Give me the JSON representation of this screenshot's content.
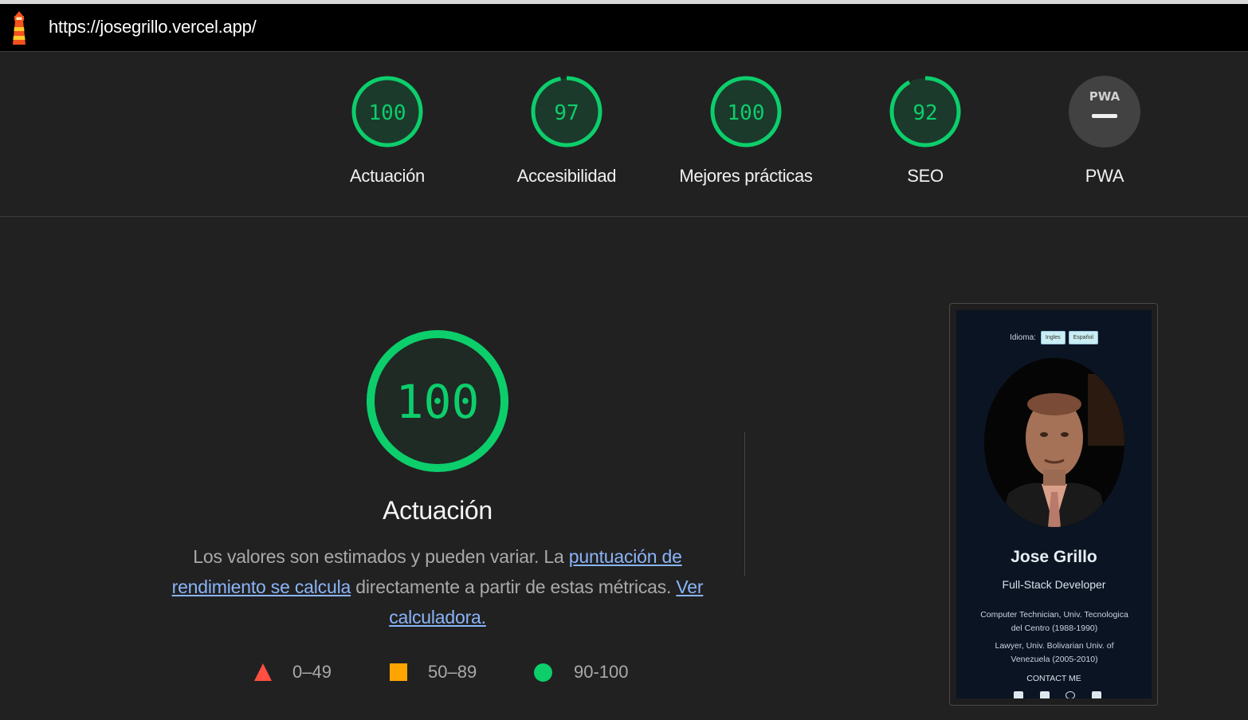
{
  "header": {
    "logo_icon": "lighthouse-icon",
    "url": "https://josegrillo.vercel.app/"
  },
  "scores": [
    {
      "value": "100",
      "label": "Actuación",
      "fraction": 1.0
    },
    {
      "value": "97",
      "label": "Accesibilidad",
      "fraction": 0.97
    },
    {
      "value": "100",
      "label": "Mejores prácticas",
      "fraction": 1.0
    },
    {
      "value": "92",
      "label": "SEO",
      "fraction": 0.92
    },
    {
      "value": "",
      "label": "PWA",
      "icon": "pwa-icon"
    }
  ],
  "main": {
    "score": "100",
    "title": "Actuación",
    "desc_before": "Los valores son estimados y pueden variar. La ",
    "desc_link1": "puntuación de rendimiento se calcula",
    "desc_middle": " directamente a partir de estas métricas. ",
    "desc_link2": "Ver calculadora.",
    "legend": [
      {
        "icon": "triangle-icon",
        "range": "0–49",
        "color": "#ff4e42"
      },
      {
        "icon": "square-icon",
        "range": "50–89",
        "color": "#ffa400"
      },
      {
        "icon": "circle-icon",
        "range": "90-100",
        "color": "#0cce6b"
      }
    ]
  },
  "screenshot": {
    "idioma_label": "Idioma:",
    "lang_en": "Ingles",
    "lang_es": "Español",
    "name": "Jose Grillo",
    "role": "Full-Stack Developer",
    "edu1": "Computer Technician, Univ. Tecnologica del Centro (1988-1990)",
    "edu2": "Lawyer, Univ. Bolivarian Univ. of Venezuela (2005-2010)",
    "contact": "CONTACT ME"
  },
  "colors": {
    "pass": "#0cce6b",
    "average": "#ffa400",
    "fail": "#ff4e42",
    "link": "#8ab4f8"
  }
}
